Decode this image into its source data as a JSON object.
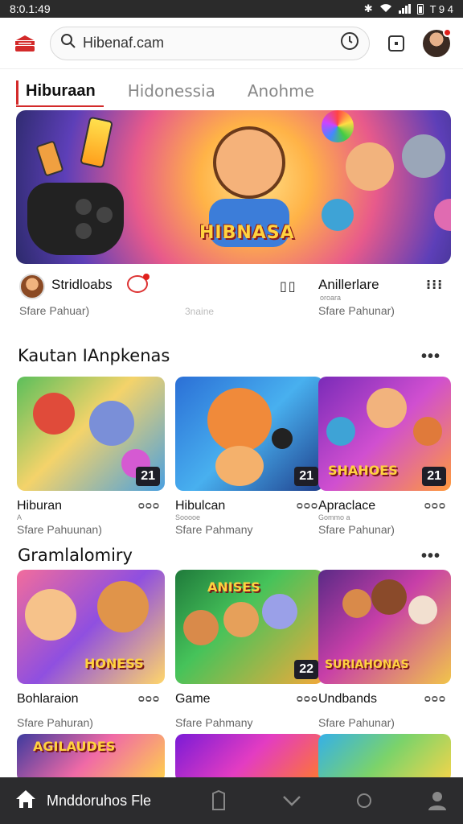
{
  "status_bar": {
    "time": "8:0.1:49",
    "right_text": "T 9 4"
  },
  "search": {
    "value": "Hibenaf.cam"
  },
  "tabs": [
    {
      "label": "Hiburaan",
      "active": true
    },
    {
      "label": "Hidonessia",
      "active": false
    },
    {
      "label": "Anohme",
      "active": false
    }
  ],
  "hero": {
    "banner_text": "HIBNASA"
  },
  "channel": {
    "name": "Stridloabs",
    "subtitle": "Sfare Pahuar)",
    "middle_text": "3naine",
    "pause_glyph": "▯▯",
    "right_name": "Anillerlare",
    "right_meta": "oroara",
    "right_subtitle": "Sfare Pahunar)",
    "more": "⁝⁝⁝"
  },
  "section1": {
    "title": "Kautan IAnpkenas",
    "more": "•••"
  },
  "section1_cards": [
    {
      "title": "Hiburan",
      "meta": "A",
      "subtitle": "Sfare Pahuunan)",
      "views": "ᴑᴑᴑ",
      "count": "21",
      "banner": "",
      "gradient": "g-a"
    },
    {
      "title": "Hibulcan",
      "meta": "Sooooe",
      "subtitle": "Sfare Pahmany",
      "views": "ᴑᴑᴑ",
      "count": "21",
      "banner": "",
      "gradient": "g-b"
    },
    {
      "title": "Apraclace",
      "meta": "Gommo a",
      "subtitle": "Sfare Pahunar)",
      "views": "ᴑᴑᴑ",
      "count": "21",
      "banner": "SHAHOES",
      "gradient": "g-c"
    }
  ],
  "section2": {
    "title": "Gramlalomiry",
    "more": "•••"
  },
  "section2_cards": [
    {
      "title": "Bohlaraion",
      "meta": "",
      "subtitle": "Sfare Pahuran)",
      "views": "ᴑᴑᴑ",
      "count": "",
      "banner": "HONESS",
      "gradient": "g-d"
    },
    {
      "title": "Game",
      "meta": "",
      "subtitle": "Sfare Pahmany",
      "views": "ᴑᴑᴑ",
      "count": "22",
      "banner": "ANISES",
      "gradient": "g-e"
    },
    {
      "title": "Undbands",
      "meta": "",
      "subtitle": "Sfare Pahunar)",
      "views": "ᴑᴑᴑ",
      "count": "",
      "banner": "SURIAHONAS",
      "gradient": "g-f"
    }
  ],
  "section3_cards": [
    {
      "banner": "AGILAUDES",
      "gradient": "g-g"
    },
    {
      "banner": "",
      "gradient": "g-h"
    },
    {
      "banner": "",
      "gradient": "g-i"
    }
  ],
  "bottom_nav": {
    "home_label": "Mnddoruhos Fle"
  },
  "colors": {
    "accent": "#d32a2a",
    "nav_bg": "#2c2c2e",
    "status_bg": "#2b2b2b"
  }
}
